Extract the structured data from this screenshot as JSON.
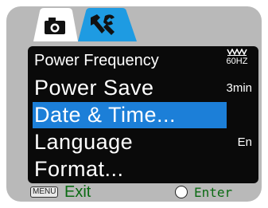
{
  "tabs": [
    {
      "icon": "camera-icon",
      "active": false
    },
    {
      "icon": "tools-icon",
      "active": true
    }
  ],
  "menu": {
    "items": [
      {
        "label": "Power Frequency",
        "value": "60HZ"
      },
      {
        "label": "Power Save",
        "value": "3min"
      },
      {
        "label": "Date & Time...",
        "value": "",
        "selected": true
      },
      {
        "label": "Language",
        "value": "En"
      },
      {
        "label": "Format...",
        "value": ""
      }
    ]
  },
  "footer": {
    "menu_badge": "MENU",
    "exit_label": "Exit",
    "enter_label": "Enter"
  },
  "colors": {
    "screen_bg": "#b9b9b9",
    "menu_bg": "#0a0a0a",
    "selection": "#1c7fd8",
    "tab_active": "#1e9be2",
    "footer_text": "#0a6a12"
  }
}
